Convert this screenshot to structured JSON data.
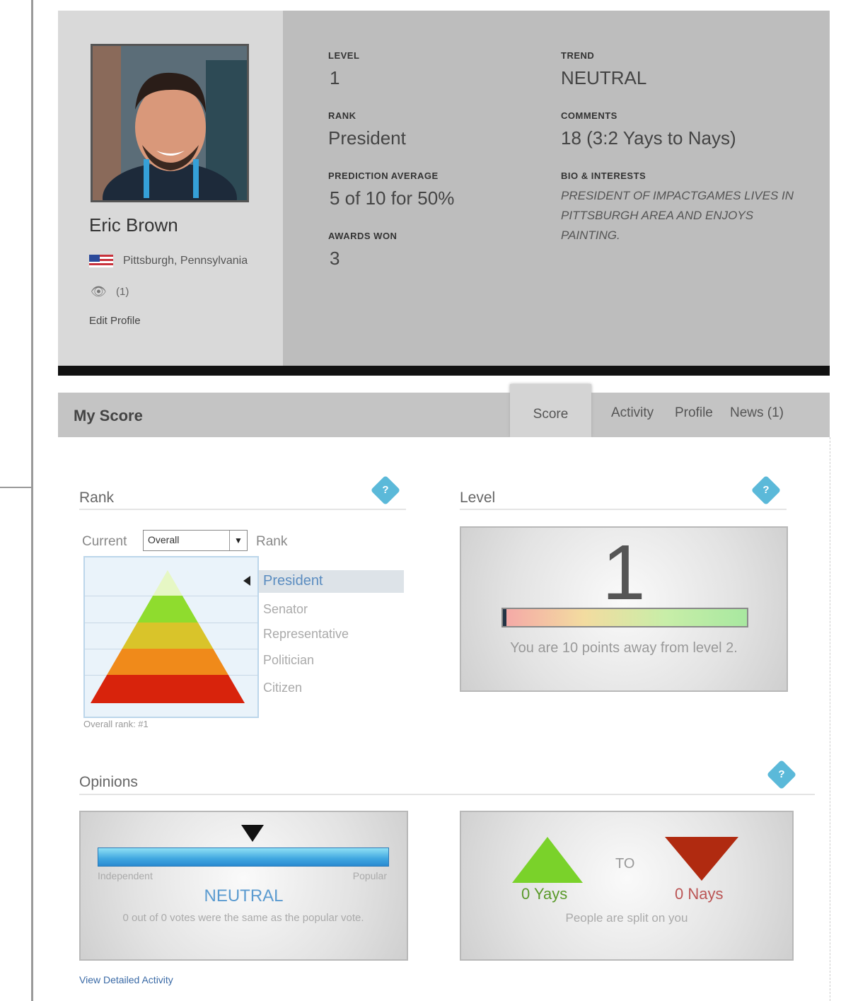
{
  "profile": {
    "name": "Eric Brown",
    "location": "Pittsburgh, Pennsylvania",
    "views": "(1)",
    "edit_link": "Edit Profile"
  },
  "stats": {
    "level_label": "LEVEL",
    "level_value": "1",
    "rank_label": "RANK",
    "rank_value": "President",
    "prediction_label": "PREDICTION AVERAGE",
    "prediction_value": "5 of 10 for 50%",
    "awards_label": "AWARDS WON",
    "awards_value": "3",
    "trend_label": "TREND",
    "trend_value": "NEUTRAL",
    "comments_label": "COMMENTS",
    "comments_value": "18 (3:2 Yays to Nays)",
    "bio_label": "BIO & INTERESTS",
    "bio_value": "President of ImpactGames lives in Pittsburgh area and enjoys painting."
  },
  "tabs": {
    "title": "My Score",
    "items": [
      "Score",
      "Activity",
      "Profile",
      "News (1)"
    ],
    "active": "Score"
  },
  "rank_section": {
    "title": "Rank",
    "current_label": "Current",
    "select_value": "Overall",
    "rank_label": "Rank",
    "ranks": [
      "President",
      "Senator",
      "Representative",
      "Politician",
      "Citizen"
    ],
    "current_rank": "President",
    "overall_rank": "Overall rank: #1"
  },
  "level_section": {
    "title": "Level",
    "level": "1",
    "progress_note": "You are 10 points away from level 2."
  },
  "opinions_section": {
    "title": "Opinions",
    "left_label": "Independent",
    "right_label": "Popular",
    "status": "NEUTRAL",
    "description": "0 out of 0 votes were the same as the popular vote.",
    "to_label": "TO",
    "yays": "0 Yays",
    "nays": "0 Nays",
    "summary": "People are split on you"
  },
  "footer": {
    "detailed_link": "View Detailed Activity"
  },
  "colors": {
    "help_icon": "#5bb9d9",
    "yay_green": "#7ad22a",
    "nay_red": "#b02a10",
    "link_blue": "#3a6aa6"
  }
}
